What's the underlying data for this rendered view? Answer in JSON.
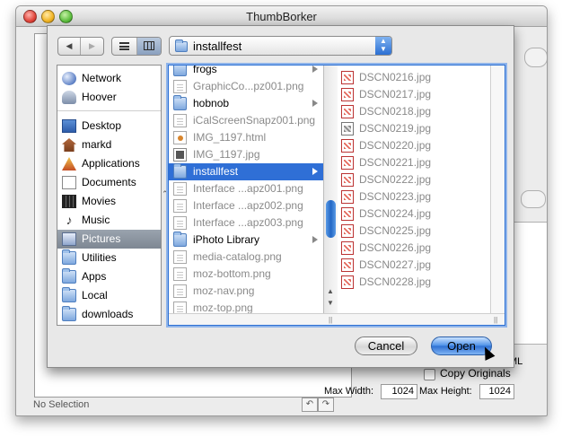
{
  "window": {
    "title": "ThumbBorker",
    "status": "No Selection"
  },
  "options": {
    "copy_originals": "Copy Originals",
    "max_width_label": "Max Width:",
    "max_width": "1024",
    "max_height_label": "Max Height:",
    "max_height": "1024",
    "fragment_ml": "ML"
  },
  "sheet": {
    "path": "installfest",
    "sidebar": [
      {
        "label": "Network",
        "icon": "globe-icon"
      },
      {
        "label": "Hoover",
        "icon": "person-icon"
      },
      {
        "label": "Desktop",
        "icon": "desktop-icon"
      },
      {
        "label": "markd",
        "icon": "home-icon"
      },
      {
        "label": "Applications",
        "icon": "applications-icon"
      },
      {
        "label": "Documents",
        "icon": "documents-icon"
      },
      {
        "label": "Movies",
        "icon": "movies-icon"
      },
      {
        "label": "Music",
        "icon": "music-icon"
      },
      {
        "label": "Pictures",
        "icon": "pictures-icon"
      },
      {
        "label": "Utilities",
        "icon": "folder-icon"
      },
      {
        "label": "Apps",
        "icon": "folder-icon"
      },
      {
        "label": "Local",
        "icon": "folder-icon"
      },
      {
        "label": "downloads",
        "icon": "folder-icon"
      }
    ],
    "column1": [
      {
        "name": "frogs",
        "kind": "folder"
      },
      {
        "name": "GraphicCo...pz001.png",
        "kind": "file"
      },
      {
        "name": "hobnob",
        "kind": "folder"
      },
      {
        "name": "iCalScreenSnapz001.png",
        "kind": "file"
      },
      {
        "name": "IMG_1197.html",
        "kind": "html"
      },
      {
        "name": "IMG_1197.jpg",
        "kind": "photo"
      },
      {
        "name": "installfest",
        "kind": "folder"
      },
      {
        "name": "Interface ...apz001.png",
        "kind": "file"
      },
      {
        "name": "Interface ...apz002.png",
        "kind": "file"
      },
      {
        "name": "Interface ...apz003.png",
        "kind": "file"
      },
      {
        "name": "iPhoto Library",
        "kind": "folder"
      },
      {
        "name": "media-catalog.png",
        "kind": "file"
      },
      {
        "name": "moz-bottom.png",
        "kind": "file"
      },
      {
        "name": "moz-nav.png",
        "kind": "file"
      },
      {
        "name": "moz-top.png",
        "kind": "file"
      }
    ],
    "column2": [
      "DSCN0216.jpg",
      "DSCN0217.jpg",
      "DSCN0218.jpg",
      "DSCN0219.jpg",
      "DSCN0220.jpg",
      "DSCN0221.jpg",
      "DSCN0222.jpg",
      "DSCN0223.jpg",
      "DSCN0224.jpg",
      "DSCN0225.jpg",
      "DSCN0226.jpg",
      "DSCN0227.jpg",
      "DSCN0228.jpg"
    ],
    "cancel_label": "Cancel",
    "open_label": "Open"
  },
  "colors": {
    "selection": "#2f6fd6",
    "default_button": "#4a8fe8"
  }
}
